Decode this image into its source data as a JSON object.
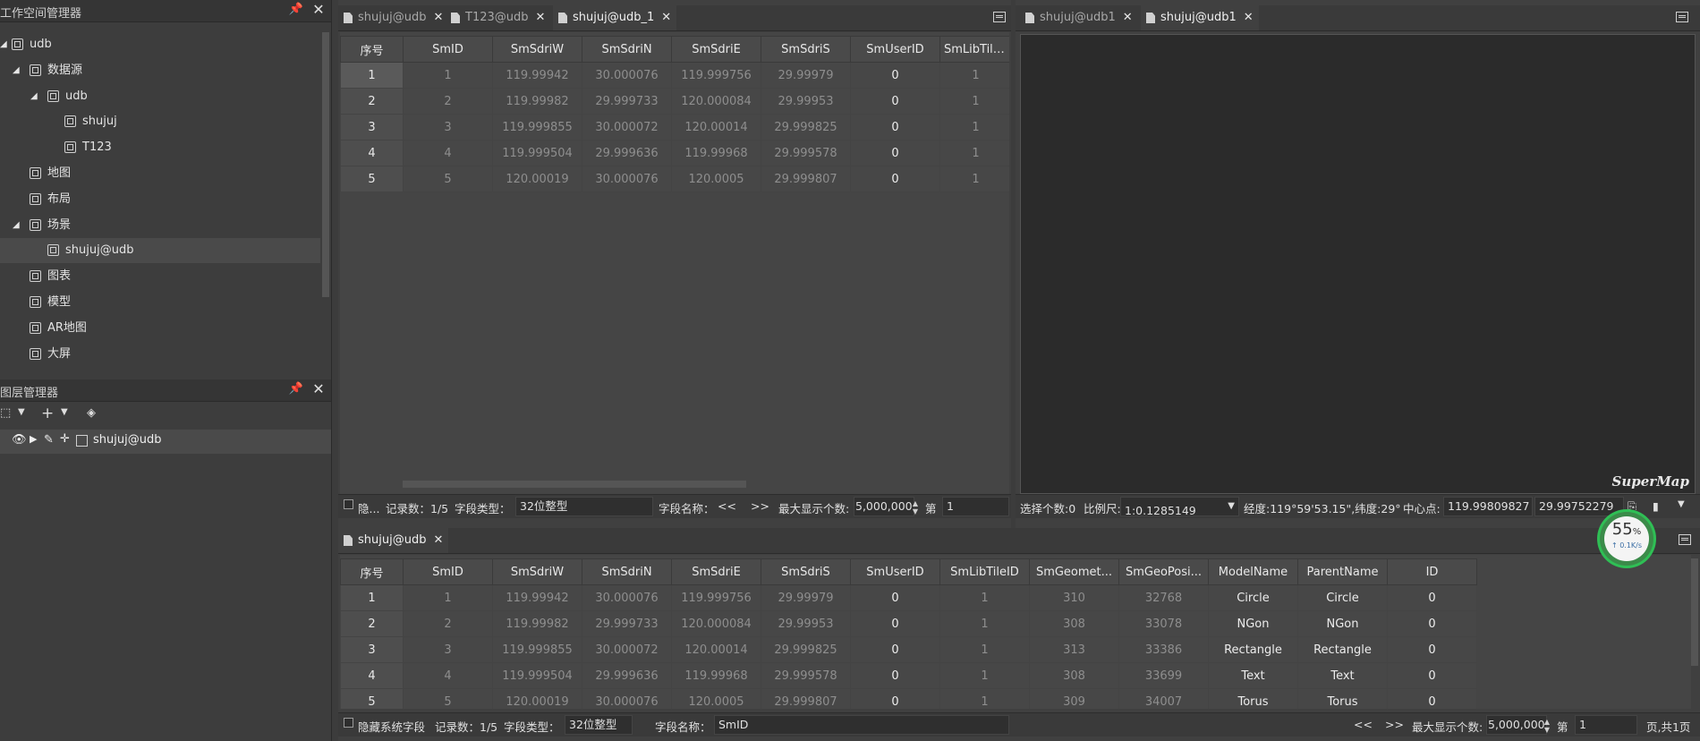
{
  "workspace_panel": {
    "title": "工作空间管理器",
    "tree": [
      {
        "label": "udb",
        "level": 0,
        "expanded": true
      },
      {
        "label": "数据源",
        "level": 1,
        "expanded": true
      },
      {
        "label": "udb",
        "level": 2,
        "expanded": true
      },
      {
        "label": "shujuj",
        "level": 3
      },
      {
        "label": "T123",
        "level": 3
      },
      {
        "label": "地图",
        "level": 1
      },
      {
        "label": "布局",
        "level": 1
      },
      {
        "label": "场景",
        "level": 1,
        "expanded": true
      },
      {
        "label": "shujuj@udb",
        "level": 2,
        "selected": true
      },
      {
        "label": "图表",
        "level": 1
      },
      {
        "label": "模型",
        "level": 1
      },
      {
        "label": "AR地图",
        "level": 1
      },
      {
        "label": "大屏",
        "level": 1
      }
    ]
  },
  "layer_panel": {
    "title": "图层管理器",
    "add_label": "+",
    "layer_name": "shujuj@udb"
  },
  "top_tabs": [
    {
      "label": "shujuj@udb",
      "active": false
    },
    {
      "label": "T123@udb",
      "active": false
    },
    {
      "label": "shujuj@udb_1",
      "active": true
    }
  ],
  "scene_tabs": [
    {
      "label": "shujuj@udb1",
      "active": false
    },
    {
      "label": "shujuj@udb1",
      "active": true
    }
  ],
  "bottom_tabs": [
    {
      "label": "shujuj@udb",
      "active": true
    }
  ],
  "table_columns_top": [
    "序号",
    "SmID",
    "SmSdriW",
    "SmSdriN",
    "SmSdriE",
    "SmSdriS",
    "SmUserID",
    "SmLibTileID"
  ],
  "table_columns_bottom": [
    "序号",
    "SmID",
    "SmSdriW",
    "SmSdriN",
    "SmSdriE",
    "SmSdriS",
    "SmUserID",
    "SmLibTileID",
    "SmGeomet...",
    "SmGeoPosi...",
    "ModelName",
    "ParentName",
    "ID"
  ],
  "rows": [
    [
      "1",
      "1",
      "119.99942",
      "30.000076",
      "119.999756",
      "29.99979",
      "0",
      "1",
      "310",
      "32768",
      "Circle",
      "Circle",
      "0"
    ],
    [
      "2",
      "2",
      "119.99982",
      "29.999733",
      "120.000084",
      "29.99953",
      "0",
      "1",
      "308",
      "33078",
      "NGon",
      "NGon",
      "0"
    ],
    [
      "3",
      "3",
      "119.999855",
      "30.000072",
      "120.00014",
      "29.999825",
      "0",
      "1",
      "313",
      "33386",
      "Rectangle",
      "Rectangle",
      "0"
    ],
    [
      "4",
      "4",
      "119.999504",
      "29.999636",
      "119.99968",
      "29.999578",
      "0",
      "1",
      "308",
      "33699",
      "Text",
      "Text",
      "0"
    ],
    [
      "5",
      "5",
      "120.00019",
      "30.000076",
      "120.0005",
      "29.999807",
      "0",
      "1",
      "309",
      "34007",
      "Torus",
      "Torus",
      "0"
    ]
  ],
  "top_status": {
    "hide_label": "隐...",
    "records": "记录数：1/5",
    "field_type_label": "字段类型：",
    "field_type_value": "32位整型",
    "field_name_label": "字段名称：",
    "prev": "<<",
    "next": ">>",
    "max_label": "最大显示个数:",
    "max_value": "5,000,000",
    "page_label": "第",
    "page_value": "1"
  },
  "bottom_status": {
    "hide_label": "隐藏系统字段",
    "records": "记录数：1/5",
    "field_type_label": "字段类型：",
    "field_type_value": "32位整型",
    "field_name_label": "字段名称：",
    "field_name_value": "SmID",
    "prev": "<<",
    "next": ">>",
    "max_label": "最大显示个数:",
    "max_value": "5,000,000",
    "page_label": "第",
    "page_value": "1",
    "pages": "页,共1页"
  },
  "scene_status": {
    "select_count": "选择个数:0",
    "scale_label": "比例尺:",
    "scale_value": "1:0.1285149",
    "coords": "经度:119°59'53.15\",纬度:29°",
    "center_label": "中心点:",
    "center_x": "119.99809827",
    "center_y": "29.99752279"
  },
  "scene": {
    "logo": "SuperMap",
    "background": "#2b2b2b"
  },
  "net_widget": {
    "percent": "55",
    "percent_sign": "%",
    "speed": "↑ 0.1K/s"
  }
}
